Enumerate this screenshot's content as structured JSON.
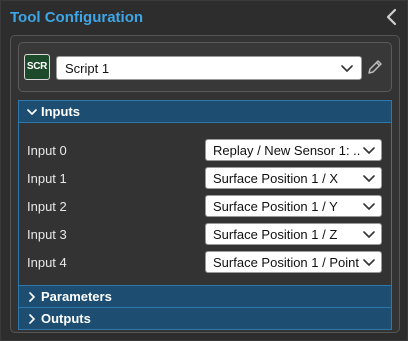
{
  "panel": {
    "title": "Tool Configuration",
    "collapse_icon": "chevron-left-icon"
  },
  "script": {
    "badge": "SCR",
    "selected": "Script 1",
    "edit_icon": "pencil-icon"
  },
  "sections": {
    "inputs": {
      "label": "Inputs",
      "expanded": true
    },
    "parameters": {
      "label": "Parameters",
      "expanded": false
    },
    "outputs": {
      "label": "Outputs",
      "expanded": false
    }
  },
  "inputs": [
    {
      "label": "Input 0",
      "value": "Replay / New Sensor 1: ..."
    },
    {
      "label": "Input 1",
      "value": "Surface Position 1 / X"
    },
    {
      "label": "Input 2",
      "value": "Surface Position 1 / Y"
    },
    {
      "label": "Input 3",
      "value": "Surface Position 1 / Z"
    },
    {
      "label": "Input 4",
      "value": "Surface Position 1 / Point"
    }
  ],
  "colors": {
    "title": "#3ea6e6",
    "section_header": "#1d4e72",
    "section_border": "#2e77aa",
    "badge_bg": "#1d4a2b",
    "background": "#2d2d2d"
  }
}
